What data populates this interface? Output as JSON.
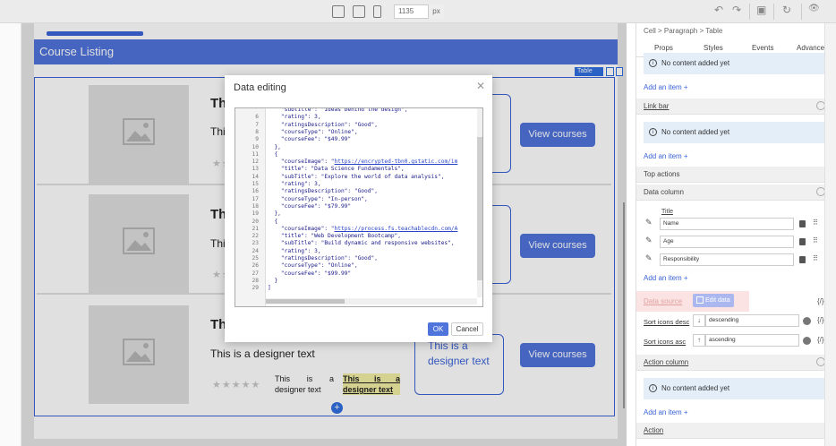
{
  "toolbar": {
    "width_value": "1135",
    "width_unit": "px",
    "undo": "↶",
    "redo": "↷",
    "save": "▣",
    "reset": "↻",
    "preview": "👁"
  },
  "canvas": {
    "header_title": "Course Listing",
    "table_tag": "Table",
    "rows": [
      {
        "title": "Th",
        "sub": "This",
        "stars": "★★★★"
      },
      {
        "title": "Th",
        "sub": "This",
        "stars": "★★"
      },
      {
        "title": "Th",
        "sub": "This is a designer text",
        "stars": "★★★★★",
        "small_text": "This is a designer text",
        "highlight_text": "This is a designer text",
        "desc_box": "This is a designer text"
      }
    ],
    "view_button": "View courses",
    "add_symbol": "+"
  },
  "modal": {
    "title": "Data editing",
    "close": "✕",
    "ok": "OK",
    "cancel": "Cancel",
    "lines": [
      {
        "n": "",
        "code": "    \"subtitle\": \"Ideas behind the design\","
      },
      {
        "n": "6",
        "code": "    \"rating\": 3,"
      },
      {
        "n": "7",
        "code": "    \"ratingsDescription\": \"Good\","
      },
      {
        "n": "8",
        "code": "    \"courseType\": \"Online\","
      },
      {
        "n": "9",
        "code": "    \"courseFee\": \"$49.99\""
      },
      {
        "n": "10",
        "code": "  },"
      },
      {
        "n": "11",
        "code": "  {"
      },
      {
        "n": "12",
        "code": "    \"courseImage\": \"",
        "url": "https://encrypted-tbn0.gstatic.com/im"
      },
      {
        "n": "13",
        "code": "    \"title\": \"Data Science Fundamentals\","
      },
      {
        "n": "14",
        "code": "    \"subTitle\": \"Explore the world of data analysis\","
      },
      {
        "n": "15",
        "code": "    \"rating\": 3,"
      },
      {
        "n": "16",
        "code": "    \"ratingsDescription\": \"Good\","
      },
      {
        "n": "17",
        "code": "    \"courseType\": \"In-person\","
      },
      {
        "n": "18",
        "code": "    \"courseFee\": \"$79.99\""
      },
      {
        "n": "19",
        "code": "  },"
      },
      {
        "n": "20",
        "code": "  {"
      },
      {
        "n": "21",
        "code": "    \"courseImage\": \"",
        "url": "https://process.fs.teachablecdn.com/A"
      },
      {
        "n": "22",
        "code": "    \"title\": \"Web Development Bootcamp\","
      },
      {
        "n": "23",
        "code": "    \"subTitle\": \"Build dynamic and responsive websites\","
      },
      {
        "n": "24",
        "code": "    \"rating\": 3,"
      },
      {
        "n": "25",
        "code": "    \"ratingsDescription\": \"Good\","
      },
      {
        "n": "26",
        "code": "    \"courseType\": \"Online\","
      },
      {
        "n": "27",
        "code": "    \"courseFee\": \"$99.99\""
      },
      {
        "n": "28",
        "code": "  }"
      },
      {
        "n": "29",
        "code": "]"
      }
    ]
  },
  "panel": {
    "breadcrumb": "Cell  >  Paragraph  >  Table",
    "tabs": [
      "Props",
      "Styles",
      "Events",
      "Advanced"
    ],
    "no_content": "No content added yet",
    "add_item": "Add an item +",
    "link_bar": "Link bar",
    "top_actions": "Top actions",
    "data_column": "Data column",
    "title_header": "Title",
    "columns": [
      "Name",
      "Age",
      "Responsibility"
    ],
    "data_source": "Data source",
    "edit_data": "Edit data",
    "fx": "{/}",
    "sort_desc_label": "Sort icons desc",
    "sort_desc_value": "descending",
    "sort_asc_label": "Sort icons asc",
    "sort_asc_value": "ascending",
    "action_column": "Action column",
    "action": "Action"
  }
}
